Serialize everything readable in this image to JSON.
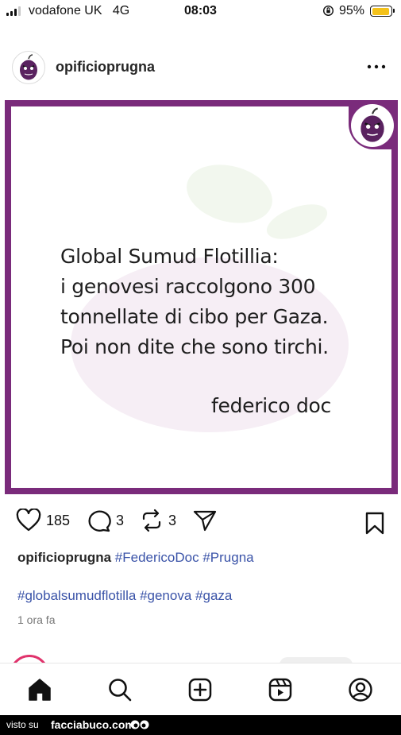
{
  "status_bar": {
    "carrier": "vodafone UK",
    "network": "4G",
    "time": "08:03",
    "battery_percent": "95%",
    "battery_level": 0.95,
    "battery_color": "#f4c21a"
  },
  "post": {
    "username": "opificioprugna",
    "more_icon": "ellipsis-horizontal-icon",
    "image": {
      "frame_color": "#7a2b7b",
      "quote_lines": [
        "Global Sumud Flotillia:",
        "i genovesi raccolgono 300",
        "tonnellate di cibo per Gaza.",
        "Poi non dite che sono tirchi."
      ],
      "author": "federico doc"
    },
    "actions": {
      "likes": "185",
      "comments": "3",
      "reposts": "3"
    },
    "caption": {
      "username": "opificioprugna",
      "hashtags_line1": [
        "#FedericoDoc",
        "#Prugna"
      ],
      "hashtags_line2": [
        "#globalsumudflotilla",
        "#genova",
        "#gaza"
      ]
    },
    "time_ago": "1 ora fa"
  },
  "bottom_nav": [
    "home-icon",
    "search-icon",
    "create-icon",
    "reels-icon",
    "profile-icon"
  ],
  "watermark": {
    "visto": "visto su",
    "site": "facciabuco.com"
  }
}
